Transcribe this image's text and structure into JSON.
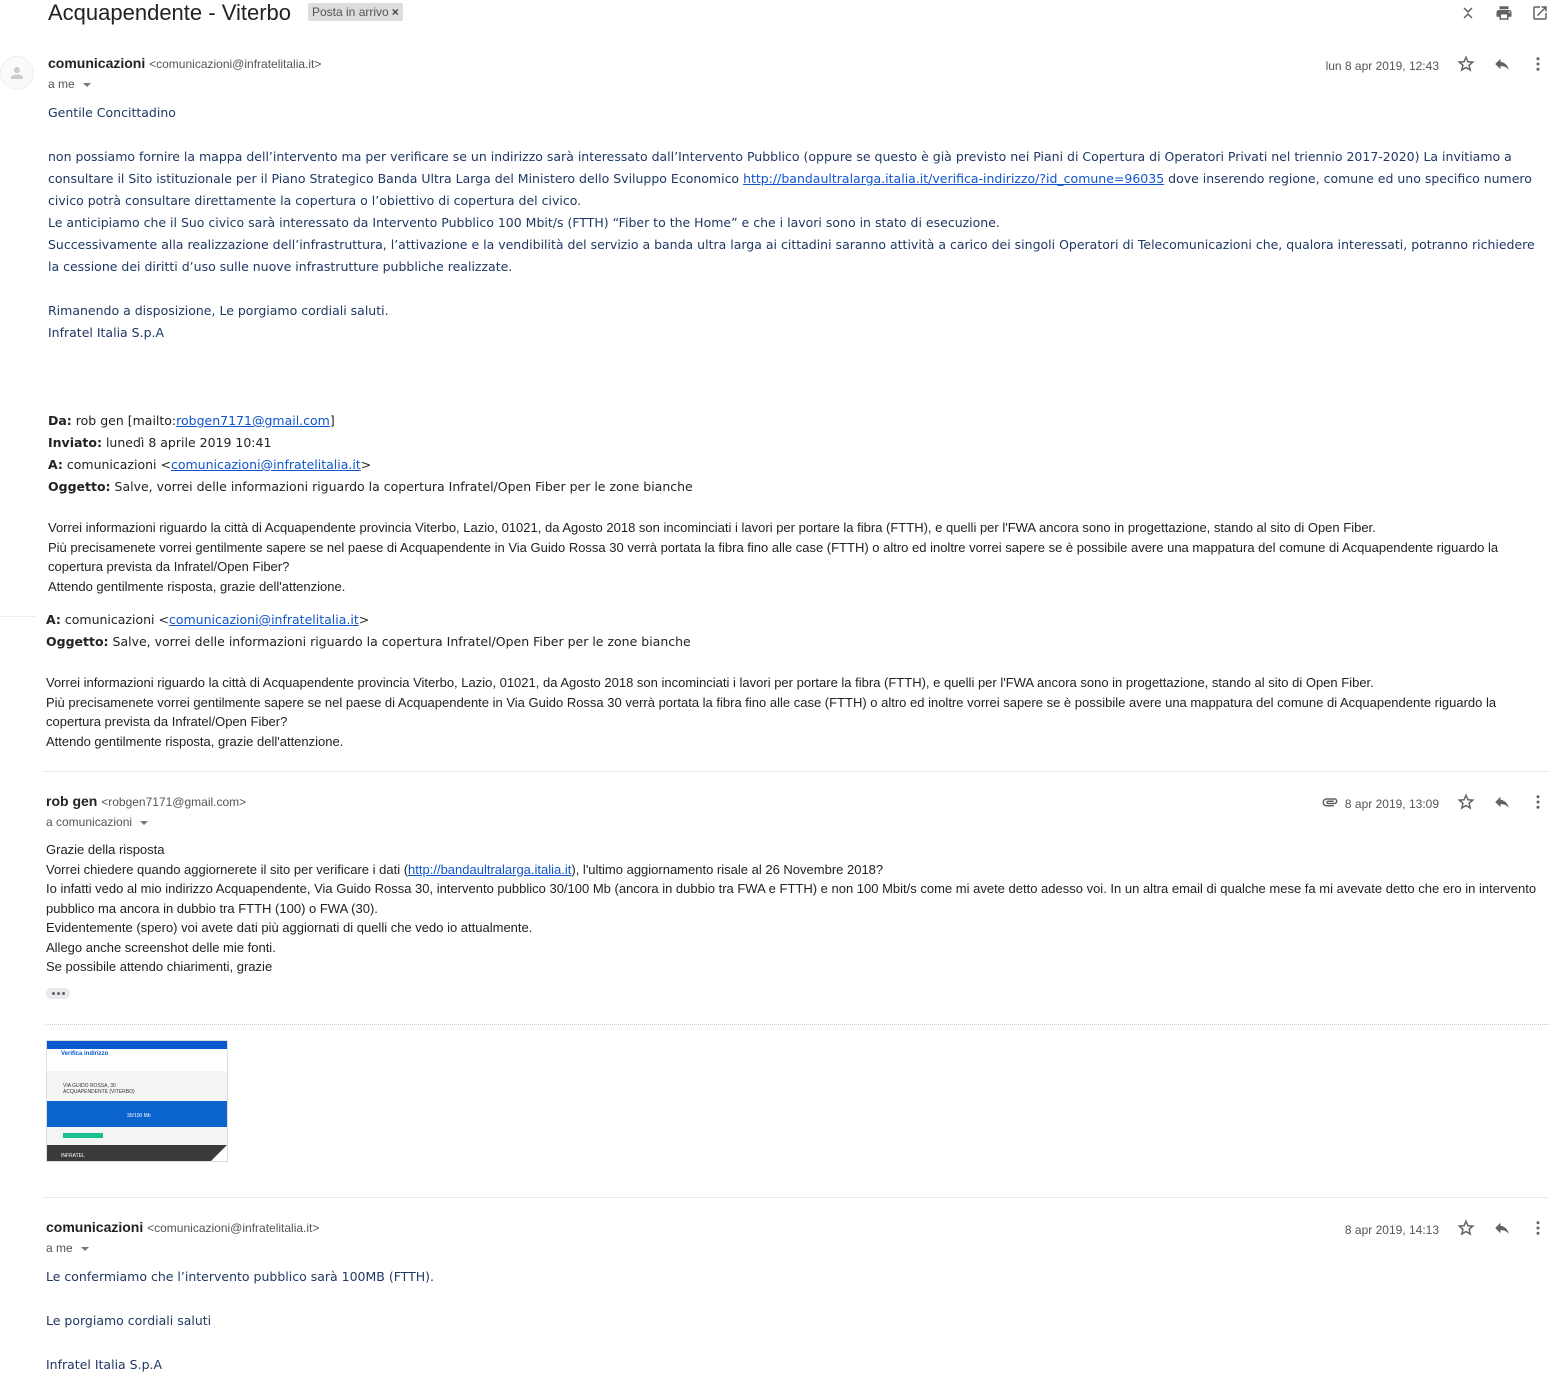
{
  "thread": {
    "subject": "Acquapendente - Viterbo",
    "label": "Posta in arrivo"
  },
  "toolbar_icons": [
    "collapse-all-icon",
    "print-icon",
    "open-new-window-icon"
  ],
  "messages": [
    {
      "sender_name": "comunicazioni",
      "sender_email": "<comunicazioni@infratelitalia.it>",
      "to": "a me",
      "date": "lun 8 apr 2019, 12:43",
      "greeting": "Gentile Concittadino",
      "p1_a": "non possiamo fornire la mappa dell’intervento ma per verificare se un indirizzo sarà interessato dall’Intervento Pubblico (oppure se questo è già previsto nei Piani di Copertura di Operatori Privati nel triennio 2017-2020) La invitiamo a consultare il Sito istituzionale per il Piano Strategico Banda Ultra Larga del Ministero dello Sviluppo Economico ",
      "p1_link": "http://bandaultralarga.italia.it/verifica-indirizzo/?id_comune=96035",
      "p1_b": " dove inserendo regione, comune ed uno specifico numero civico potrà consultare direttamente la copertura o l’obiettivo di copertura del civico.",
      "p2": "Le anticipiamo che il Suo civico sarà interessato da Intervento Pubblico 100 Mbit/s (FTTH) “Fiber to the Home” e che i lavori sono in stato di esecuzione.",
      "p3": "Successivamente alla realizzazione dell’infrastruttura, l’attivazione e la vendibilità del servizio a banda ultra larga ai cittadini saranno attività a carico dei singoli Operatori di Telecomunicazioni che, qualora interessati, potranno richiedere la cessione dei diritti d’uso sulle nuove infrastrutture pubbliche realizzate.",
      "closing": "Rimanendo a disposizione, Le porgiamo cordiali saluti.",
      "signature": "Infratel Italia S.p.A",
      "quoted": {
        "from_label": "Da:",
        "from_value": " rob gen [mailto:",
        "from_link": "robgen7171@gmail.com",
        "from_end": "]",
        "sent_label": "Inviato:",
        "sent_value": " lunedì 8 aprile 2019 10:41",
        "to_label": "A:",
        "to_value": " comunicazioni <",
        "to_link": "comunicazioni@infratelitalia.it",
        "to_end": ">",
        "subject_label": "Oggetto:",
        "subject_value": " Salve, vorrei delle informazioni riguardo la copertura Infratel/Open Fiber per le zone bianche",
        "body_1": "Vorrei informazioni riguardo la città di Acquapendente provincia Viterbo, Lazio, 01021, da Agosto 2018 son incominciati i lavori per portare la fibra (FTTH), e quelli per l'FWA ancora sono in progettazione, stando al sito di Open Fiber.",
        "body_2": "Più precisamenete vorrei gentilmente sapere se nel paese di Acquapendente in Via Guido Rossa 30 verrà portata la fibra fino alle case (FTTH) o altro ed inoltre vorrei sapere se è possibile avere una mappatura del comune di Acquapendente riguardo la copertura prevista da Infratel/Open Fiber?",
        "body_3": "Attendo gentilmente risposta, grazie dell'attenzione."
      }
    },
    {
      "sender_name": "rob gen",
      "sender_email": "<robgen7171@gmail.com>",
      "to": "a comunicazioni",
      "date": "8 apr 2019, 13:09",
      "l1": "Grazie della risposta",
      "l2_a": "Vorrei chiedere quando aggiornerete il sito per verificare i dati (",
      "l2_link": "http://bandaultralarga.italia.it",
      "l2_b": "), l'ultimo aggiornamento risale al 26 Novembre 2018?",
      "l3": "Io infatti vedo al mio indirizzo Acquapendente, Via Guido Rossa 30, intervento pubblico 30/100 Mb (ancora in dubbio tra FWA e FTTH) e non 100 Mbit/s come mi avete detto adesso voi. In un altra email di qualche mese fa mi avevate detto che ero in intervento pubblico ma ancora in dubbio tra FTTH (100) o FWA (30).",
      "l4": "Evidentemente (spero) voi avete dati più aggiornati di quelli che vedo io attualmente.",
      "l5": "Allego anche screenshot delle mie fonti.",
      "l6": "Se possibile attendo chiarimenti, grazie",
      "attachment": {
        "title": "Verifica indirizzo",
        "address": "VIA GUIDO ROSSA, 30 ACQUAPENDENTE (VITERBO)",
        "result": "30/100 Mb",
        "footer": "INFRATEL"
      }
    },
    {
      "sender_name": "comunicazioni",
      "sender_email": "<comunicazioni@infratelitalia.it>",
      "to": "a me",
      "date": "8 apr 2019, 14:13",
      "l1": "Le confermiamo che l’intervento pubblico sarà 100MB (FTTH).",
      "l2": "Le porgiamo cordiali saluti",
      "l3": "Infratel Italia S.p.A"
    }
  ]
}
